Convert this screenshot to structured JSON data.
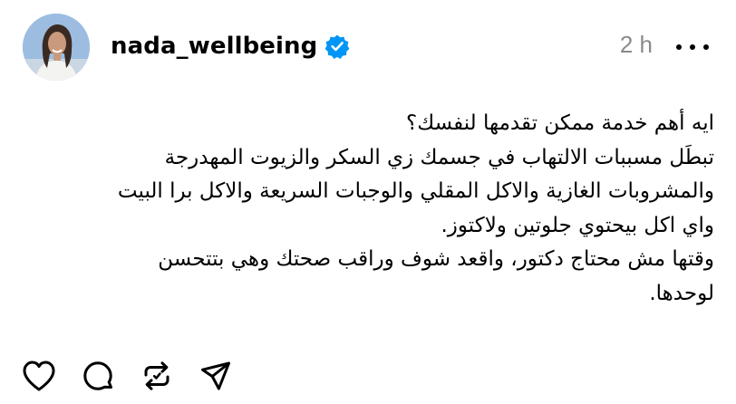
{
  "post": {
    "username": "nada_wellbeing",
    "verified": true,
    "timestamp": "2 h",
    "caption_lines": [
      "ايه أهم خدمة ممكن تقدمها لنفسك؟",
      "تبطَل مسببات الالتهاب في جسمك زي السكر والزيوت المهدرجة",
      "والمشروبات الغازية والاكل المقلي والوجبات السريعة والاكل برا البيت",
      "واي اكل بيحتوي جلوتين ولاكتوز.",
      "وقتها مش محتاج دكتور، واقعد شوف وراقب صحتك وهي بتتحسن",
      "لوحدها."
    ]
  },
  "icons": {
    "avatar": "profile-photo",
    "verified": "verified-badge-icon",
    "more": "more-options-icon",
    "like": "heart-icon",
    "comment": "comment-icon",
    "repost": "repost-icon",
    "share": "send-icon"
  },
  "colors": {
    "background": "#ffffff",
    "text": "#000000",
    "timestamp": "#8a8a8a",
    "verified_badge": "#0095f6"
  }
}
